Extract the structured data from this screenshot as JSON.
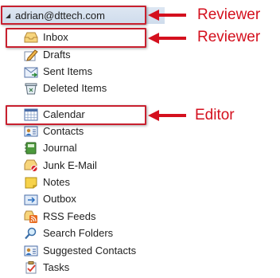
{
  "account": {
    "expander": "◢",
    "label": "adrian@dttech.com"
  },
  "folders": [
    {
      "label": "Inbox",
      "icon": "inbox-icon"
    },
    {
      "label": "Drafts",
      "icon": "drafts-icon"
    },
    {
      "label": "Sent Items",
      "icon": "sent-items-icon"
    },
    {
      "label": "Deleted Items",
      "icon": "deleted-items-icon"
    },
    {
      "label": "Calendar",
      "icon": "calendar-icon"
    },
    {
      "label": "Contacts",
      "icon": "contacts-icon"
    },
    {
      "label": "Journal",
      "icon": "journal-icon"
    },
    {
      "label": "Junk E-Mail",
      "icon": "junk-email-icon"
    },
    {
      "label": "Notes",
      "icon": "notes-icon"
    },
    {
      "label": "Outbox",
      "icon": "outbox-icon"
    },
    {
      "label": "RSS Feeds",
      "icon": "rss-feeds-icon"
    },
    {
      "label": "Search Folders",
      "icon": "search-folders-icon"
    },
    {
      "label": "Suggested Contacts",
      "icon": "suggested-contacts-icon"
    },
    {
      "label": "Tasks",
      "icon": "tasks-icon"
    }
  ],
  "annotations": {
    "account": "Reviewer",
    "inbox": "Reviewer",
    "calendar": "Editor",
    "color": "#d4101e"
  }
}
